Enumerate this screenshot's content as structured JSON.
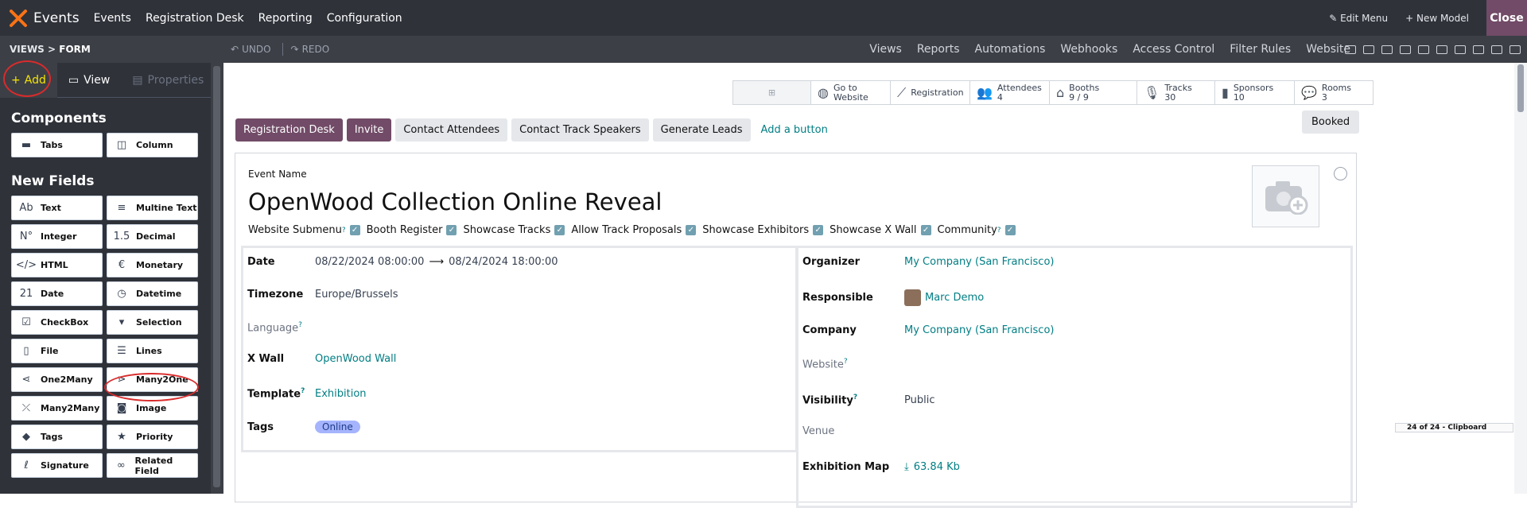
{
  "topbar": {
    "brand": "Events",
    "menus": [
      "Events",
      "Registration Desk",
      "Reporting",
      "Configuration"
    ],
    "edit_menu": "Edit Menu",
    "new_model": "New Model",
    "close": "Close"
  },
  "subbar": {
    "views": "VIEWS",
    "form": "FORM",
    "undo": "UNDO",
    "redo": "REDO",
    "links": [
      "Views",
      "Reports",
      "Automations",
      "Webhooks",
      "Access Control",
      "Filter Rules",
      "Website"
    ]
  },
  "sidebar": {
    "tabs": {
      "add": "Add",
      "view": "View",
      "properties": "Properties"
    },
    "components_title": "Components",
    "components": [
      {
        "label": "Tabs",
        "icon": "tabs-icon"
      },
      {
        "label": "Column",
        "icon": "column-icon"
      }
    ],
    "new_fields_title": "New Fields",
    "fields": [
      {
        "label": "Text",
        "icon": "text-icon",
        "glyph": "Ab"
      },
      {
        "label": "Multine Text",
        "icon": "multiline-icon",
        "glyph": "≡"
      },
      {
        "label": "Integer",
        "icon": "integer-icon",
        "glyph": "N°"
      },
      {
        "label": "Decimal",
        "icon": "decimal-icon",
        "glyph": "1.5"
      },
      {
        "label": "HTML",
        "icon": "html-icon",
        "glyph": "</>"
      },
      {
        "label": "Monetary",
        "icon": "monetary-icon",
        "glyph": "€"
      },
      {
        "label": "Date",
        "icon": "date-icon",
        "glyph": "21"
      },
      {
        "label": "Datetime",
        "icon": "datetime-icon",
        "glyph": "◷"
      },
      {
        "label": "CheckBox",
        "icon": "checkbox-icon",
        "glyph": "☑"
      },
      {
        "label": "Selection",
        "icon": "selection-icon",
        "glyph": "▾"
      },
      {
        "label": "File",
        "icon": "file-icon",
        "glyph": "▯"
      },
      {
        "label": "Lines",
        "icon": "lines-icon",
        "glyph": "☰"
      },
      {
        "label": "One2Many",
        "icon": "one2many-icon",
        "glyph": "⋖"
      },
      {
        "label": "Many2One",
        "icon": "many2one-icon",
        "glyph": "⋗"
      },
      {
        "label": "Many2Many",
        "icon": "many2many-icon",
        "glyph": "⤫"
      },
      {
        "label": "Image",
        "icon": "image-icon",
        "glyph": "◙"
      },
      {
        "label": "Tags",
        "icon": "tags-icon",
        "glyph": "◆"
      },
      {
        "label": "Priority",
        "icon": "priority-icon",
        "glyph": "★"
      },
      {
        "label": "Signature",
        "icon": "signature-icon",
        "glyph": "ℓ"
      },
      {
        "label": "Related Field",
        "icon": "related-field-icon",
        "glyph": "∞"
      }
    ]
  },
  "smart_buttons": [
    {
      "line1": "Go to",
      "line2": "Website",
      "icon": "globe-icon"
    },
    {
      "line1": "Registration",
      "line2": "",
      "icon": "chart-icon"
    },
    {
      "line1": "Attendees",
      "line2": "4",
      "icon": "users-icon"
    },
    {
      "line1": "Booths",
      "line2": "9 / 9",
      "icon": "bank-icon"
    },
    {
      "line1": "Tracks",
      "line2": "30",
      "icon": "microphone-icon"
    },
    {
      "line1": "Sponsors",
      "line2": "10",
      "icon": "badge-icon"
    },
    {
      "line1": "Rooms",
      "line2": "3",
      "icon": "comments-icon"
    }
  ],
  "actions": {
    "registration_desk": "Registration Desk",
    "invite": "Invite",
    "contact_attendees": "Contact Attendees",
    "contact_speakers": "Contact Track Speakers",
    "generate_leads": "Generate Leads",
    "add_button": "Add a button",
    "booked": "Booked"
  },
  "event": {
    "name_label": "Event Name",
    "name": "OpenWood Collection Online Reveal",
    "submenu": [
      "Website Submenu",
      "Booth Register",
      "Showcase Tracks",
      "Allow Track Proposals",
      "Showcase Exhibitors",
      "Showcase X Wall",
      "Community"
    ],
    "left": {
      "date_label": "Date",
      "date_start": "08/22/2024 08:00:00",
      "date_end": "08/24/2024 18:00:00",
      "timezone_label": "Timezone",
      "timezone": "Europe/Brussels",
      "language_label": "Language",
      "xwall_label": "X Wall",
      "xwall": "OpenWood Wall",
      "template_label": "Template",
      "template": "Exhibition",
      "tags_label": "Tags",
      "tag": "Online"
    },
    "right": {
      "organizer_label": "Organizer",
      "organizer": "My Company (San Francisco)",
      "responsible_label": "Responsible",
      "responsible": "Marc Demo",
      "company_label": "Company",
      "company": "My Company (San Francisco)",
      "website_label": "Website",
      "visibility_label": "Visibility",
      "visibility": "Public",
      "venue_label": "Venue",
      "map_label": "Exhibition Map",
      "map": "63.84 Kb"
    }
  },
  "clipboard": "24 of 24 - Clipboard",
  "colors": {
    "accent": "#714b67",
    "link": "#017e84",
    "annotation": "#d92b2b"
  }
}
